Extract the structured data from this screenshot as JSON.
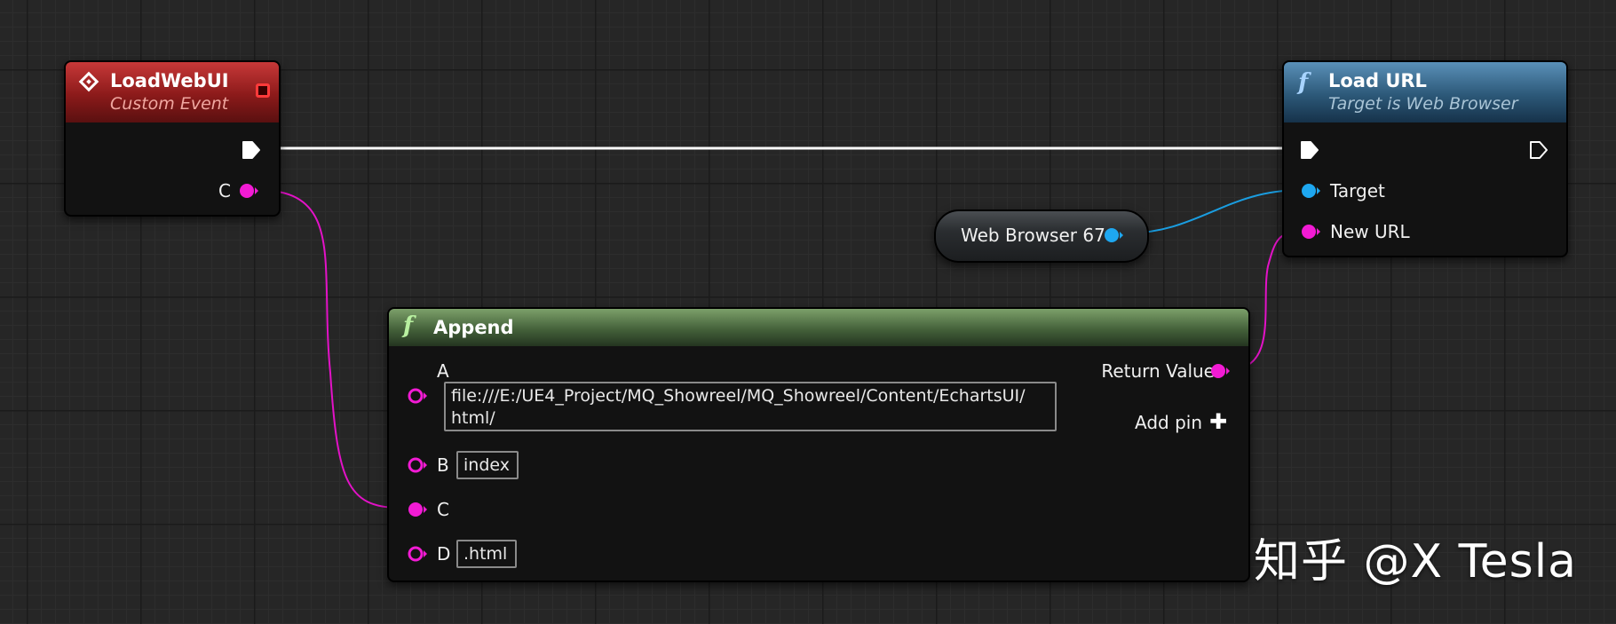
{
  "colors": {
    "exec_wire": "#ffffff",
    "string_wire": "#e312c7",
    "object_wire": "#1a9de0",
    "string_pin": "#f21bd4",
    "object_pin": "#1ea7f0",
    "event_header": "#8b1a1a",
    "function_header_blue": "#2c5878",
    "function_header_green": "#44613a"
  },
  "event_node": {
    "title": "LoadWebUI",
    "subtitle": "Custom Event",
    "icon": "event-diamond-icon",
    "output_pin_label": "C"
  },
  "load_url_node": {
    "title": "Load URL",
    "subtitle": "Target is Web Browser",
    "icon": "function-icon",
    "icon_glyph": "f",
    "pins": {
      "target": "Target",
      "new_url": "New URL"
    }
  },
  "variable_node": {
    "label": "Web Browser 67"
  },
  "append_node": {
    "title": "Append",
    "icon": "function-icon",
    "icon_glyph": "f",
    "inputs": {
      "a_label": "A",
      "a_value": "file:///E:/UE4_Project/MQ_Showreel/MQ_Showreel/Content/EchartsUI/\nhtml/",
      "b_label": "B",
      "b_value": "index",
      "c_label": "C",
      "d_label": "D",
      "d_value": ".html"
    },
    "return_label": "Return Value",
    "add_pin_label": "Add pin",
    "add_pin_icon": "plus-icon",
    "add_pin_glyph": "✚"
  },
  "watermark": "知乎 @X Tesla"
}
